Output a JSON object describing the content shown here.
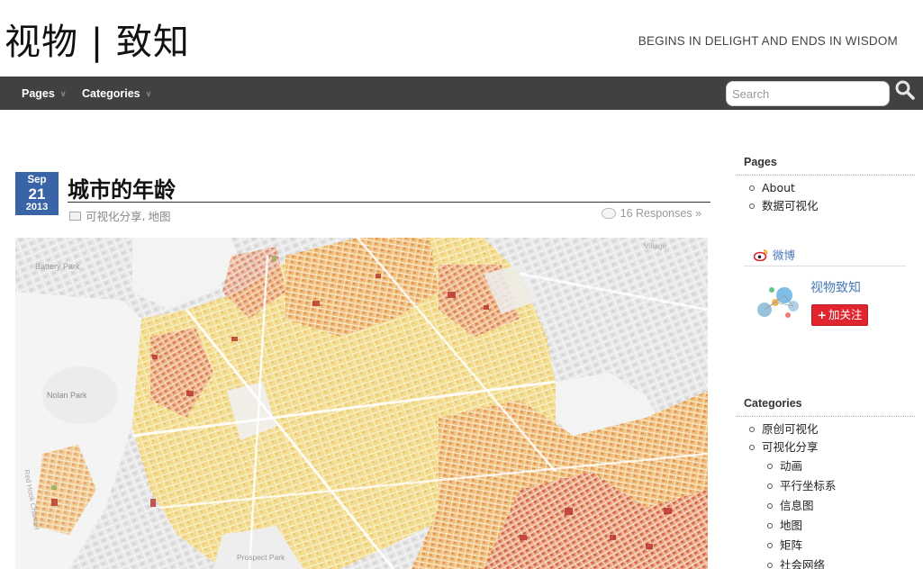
{
  "site": {
    "title": "视物 | 致知",
    "tagline": "BEGINS IN DELIGHT AND ENDS IN WISDOM"
  },
  "nav": {
    "items": [
      {
        "label": "Pages"
      },
      {
        "label": "Categories"
      }
    ],
    "search_placeholder": "Search"
  },
  "post": {
    "date": {
      "month": "Sep",
      "day": "21",
      "year": "2013"
    },
    "title": "城市的年龄",
    "categories": [
      "可视化分享",
      "地图"
    ],
    "category_sep": ",",
    "responses": "16 Responses »"
  },
  "map_labels": {
    "battery_park": "Battery Park",
    "nolan_park": "Nolan Park",
    "red_hook_channel": "Red Hook Channel",
    "prospect_park": "Prospect Park",
    "village": "Village"
  },
  "sidebar": {
    "pages_heading": "Pages",
    "pages": [
      {
        "label": "About"
      },
      {
        "label": "数据可视化"
      }
    ],
    "weibo": {
      "label": "微博",
      "name": "视物致知",
      "follow": "加关注",
      "follow_plus": "+"
    },
    "categories_heading": "Categories",
    "categories": [
      {
        "label": "原创可视化",
        "sub": false
      },
      {
        "label": "可视化分享",
        "sub": false
      },
      {
        "label": "动画",
        "sub": true
      },
      {
        "label": "平行坐标系",
        "sub": true
      },
      {
        "label": "信息图",
        "sub": true
      },
      {
        "label": "地图",
        "sub": true
      },
      {
        "label": "矩阵",
        "sub": true
      },
      {
        "label": "社会网络",
        "sub": true
      }
    ]
  },
  "colors": {
    "nav_bg": "#414141",
    "date_badge": "#3a64a8",
    "follow_button": "#e0252e",
    "link_blue": "#4a7ab8"
  }
}
